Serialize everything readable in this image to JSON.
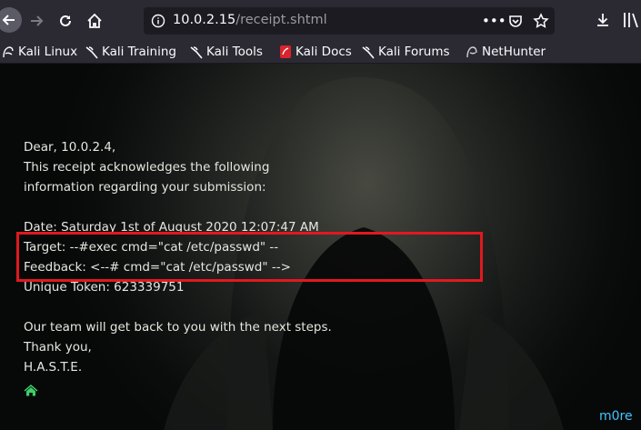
{
  "browser": {
    "url_host": "10.0.2.15",
    "url_path": "/receipt.shtml",
    "bookmarks": [
      {
        "label": "Kali Linux"
      },
      {
        "label": "Kali Training"
      },
      {
        "label": "Kali Tools"
      },
      {
        "label": "Kali Docs"
      },
      {
        "label": "Kali Forums"
      },
      {
        "label": "NetHunter"
      }
    ]
  },
  "receipt": {
    "greeting": "Dear, 10.0.2.4,",
    "intro_line1": "This receipt acknowledges the following",
    "intro_line2": "information regarding your submission:",
    "date": "Date: Saturday 1st of August 2020 12:07:47 AM",
    "target": "Target: --#exec cmd=\"cat /etc/passwd\" --",
    "feedback": "Feedback: <--# cmd=\"cat /etc/passwd\" -->",
    "token": "Unique Token: 623339751",
    "closing": "Our team will get back to you with the next steps.",
    "thanks": "Thank you,",
    "signature": "H.A.S.T.E.",
    "more_link": "m0re"
  },
  "colors": {
    "highlight": "#e0191f",
    "link": "#44c3ff",
    "home_icon": "#3ecf6a"
  }
}
